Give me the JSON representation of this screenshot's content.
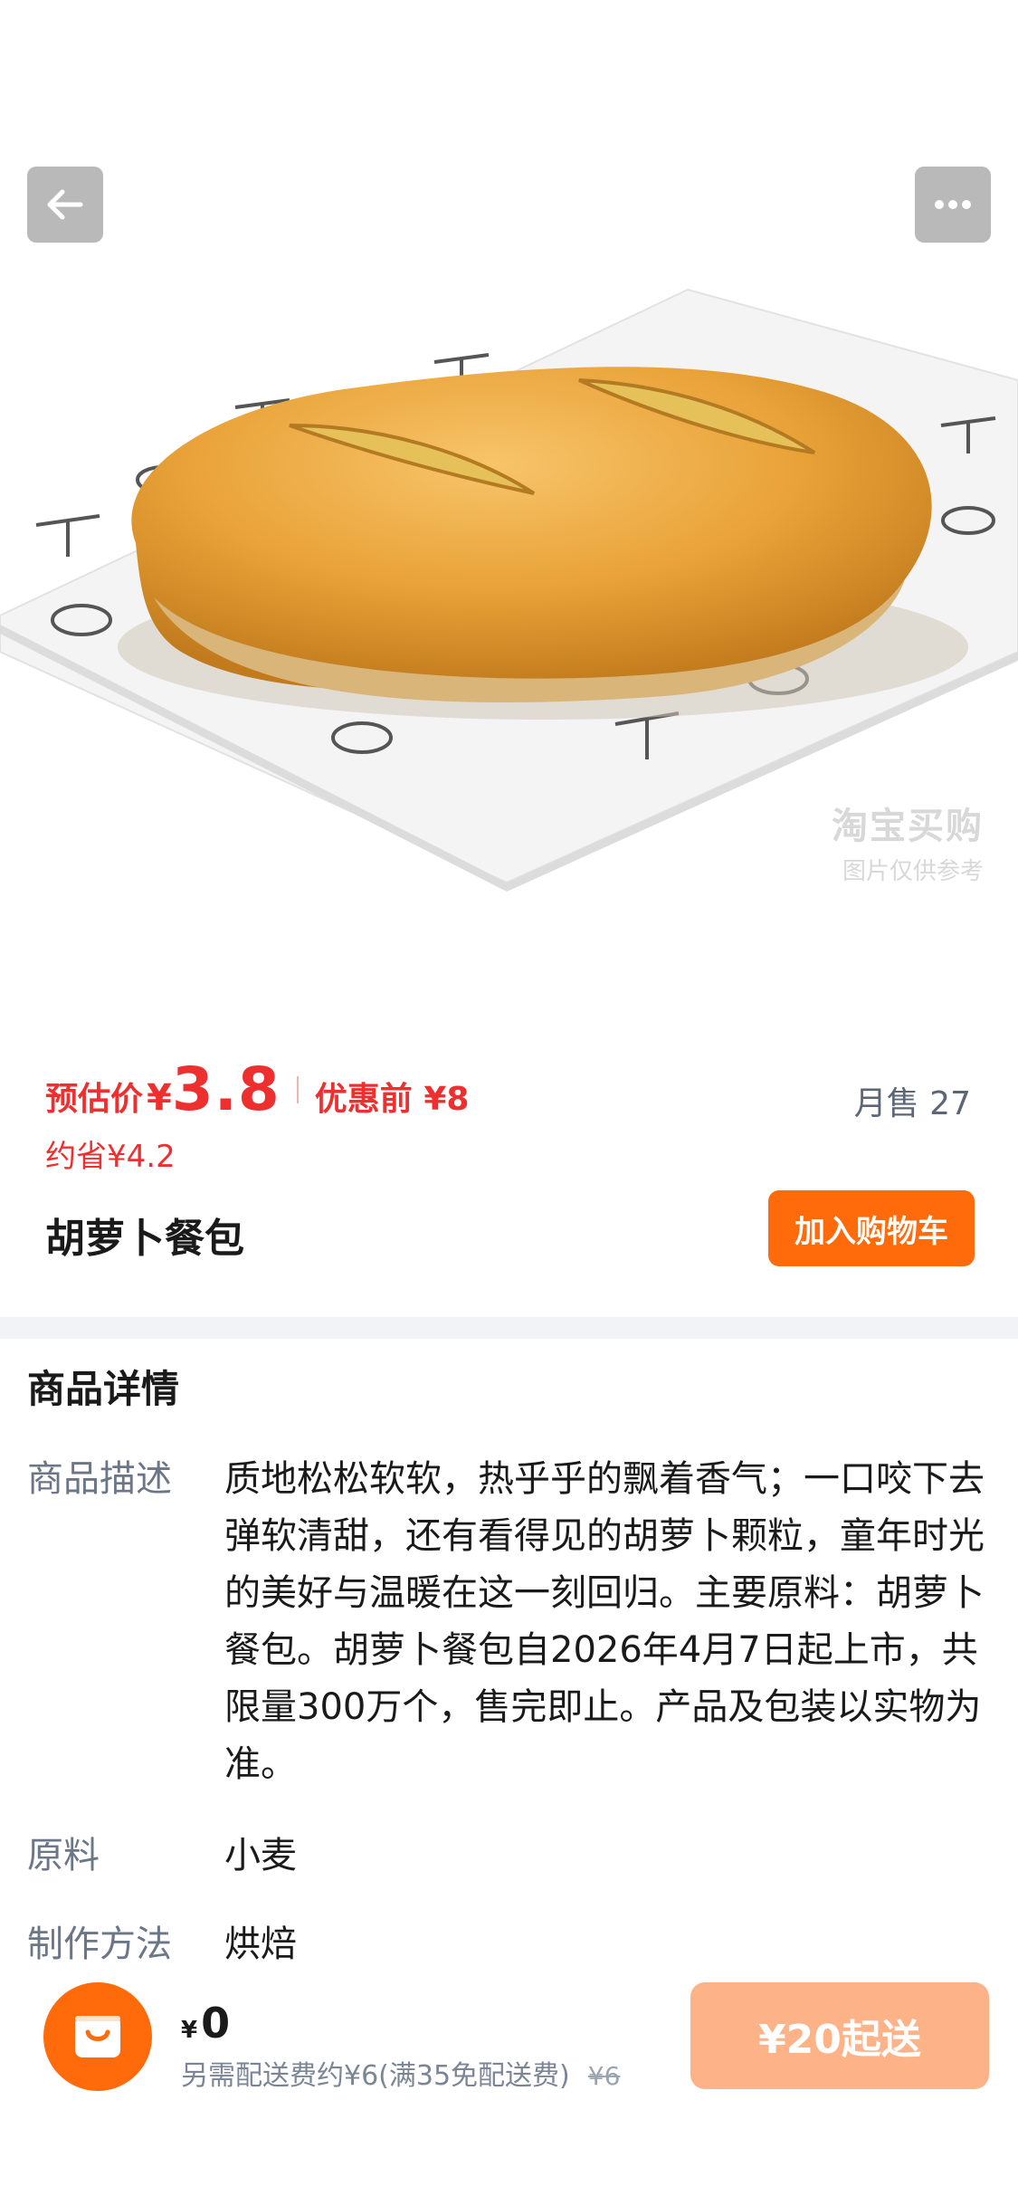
{
  "header": {
    "back_icon": "arrow-left-icon",
    "more_icon": "more-horizontal-icon"
  },
  "image": {
    "watermark_line1": "淘宝买购",
    "watermark_line2": "图片仅供参考"
  },
  "price": {
    "label": "预估价",
    "currency": "¥",
    "value": "3.8",
    "before_label": "优惠前 ¥8",
    "saving": "约省¥4.2",
    "monthly_sales": "月售 27"
  },
  "product": {
    "title": "胡萝卜餐包",
    "add_to_cart": "加入购物车"
  },
  "details": {
    "heading": "商品详情",
    "rows": [
      {
        "key": "商品描述",
        "value": "质地松松软软，热乎乎的飘着香气；一口咬下去弹软清甜，还有看得见的胡萝卜颗粒，童年时光的美好与温暖在这一刻回归。主要原料：胡萝卜餐包。胡萝卜餐包自2026年4月7日起上市，共限量300万个，售完即止。产品及包装以实物为准。"
      },
      {
        "key": "原料",
        "value": "小麦"
      },
      {
        "key": "制作方法",
        "value": "烘焙"
      }
    ]
  },
  "bottom_bar": {
    "cart_icon": "shopping-bag-icon",
    "currency": "¥",
    "total": "0",
    "fee_text": "另需配送费约¥6(满35免配送费)",
    "fee_original": "¥6",
    "min_order": "¥20起送"
  },
  "colors": {
    "accent_orange": "#ff6a0a",
    "price_red": "#ee2f2f",
    "disabled_orange": "#fdb387",
    "muted_text": "#6b7686"
  }
}
